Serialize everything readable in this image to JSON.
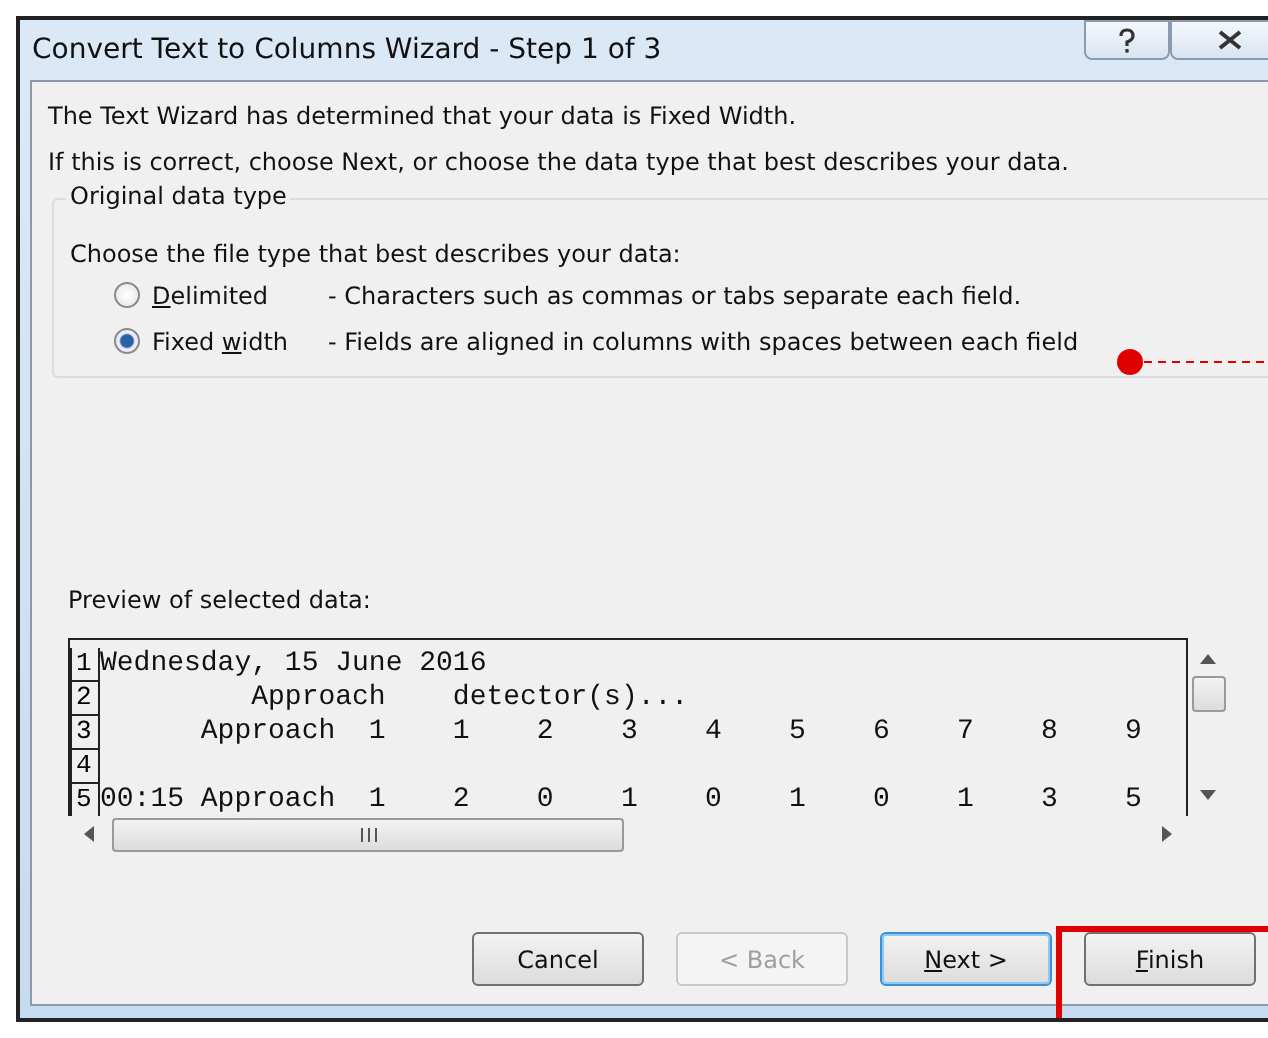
{
  "window": {
    "title": "Convert Text to Columns Wizard - Step 1 of 3"
  },
  "intro": [
    "The Text Wizard has determined that your data is Fixed Width.",
    "If this is correct, choose Next, or choose the data type that best describes your data."
  ],
  "group": {
    "title": "Original data type",
    "prompt": "Choose the file type that best describes your data:",
    "options": [
      {
        "label_parts": {
          "key": "D",
          "after": "elimited"
        },
        "description": "- Characters such as commas or tabs separate each field.",
        "selected": false
      },
      {
        "label_parts": {
          "before": "Fixed ",
          "key": "w",
          "after": "idth"
        },
        "description": "- Fields are aligned in columns with spaces between each field",
        "selected": true
      }
    ]
  },
  "preview": {
    "title": "Preview of selected data:",
    "rows": [
      {
        "number": "1",
        "text": "Wednesday, 15 June 2016"
      },
      {
        "number": "2",
        "text": "         Approach    detector(s)..."
      },
      {
        "number": "3",
        "text": "      Approach  1    1    2    3    4    5    6    7    8    9"
      },
      {
        "number": "4"
      },
      {
        "number": "5",
        "text": "00:15 Approach  1    2    0    1    0    1    0    1    3    5"
      }
    ]
  },
  "buttons": [
    {
      "label_parts": {
        "before": "Cancel"
      },
      "disabled": false,
      "default": false
    },
    {
      "label_parts": {
        "before": "< Back"
      },
      "disabled": true,
      "default": false
    },
    {
      "label_parts": {
        "key": "N",
        "after": "ext >"
      },
      "disabled": false,
      "default": true
    },
    {
      "label_parts": {
        "key": "F",
        "after": "inish"
      },
      "disabled": false,
      "default": false
    }
  ]
}
